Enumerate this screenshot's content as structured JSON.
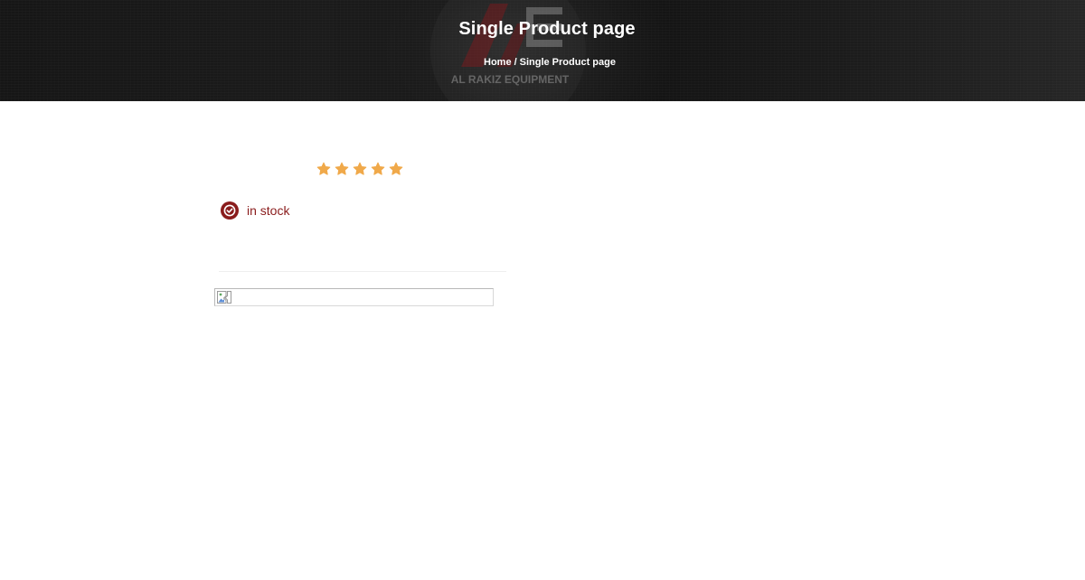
{
  "hero": {
    "title": "Single Product page",
    "logo_text": "AL RAKIZ EQUIPMENT"
  },
  "breadcrumb": {
    "home_label": "Home",
    "separator": "/",
    "current_label": "Single Product page"
  },
  "product": {
    "rating": 5,
    "rating_max": 5,
    "stock_label": "in stock"
  },
  "colors": {
    "star": "#f0a94a",
    "stock": "#8a1c1c",
    "hero_text": "#ffffff"
  },
  "icons": {
    "star": "star-icon",
    "stock": "check-circle-icon",
    "broken_image": "broken-image-icon"
  }
}
